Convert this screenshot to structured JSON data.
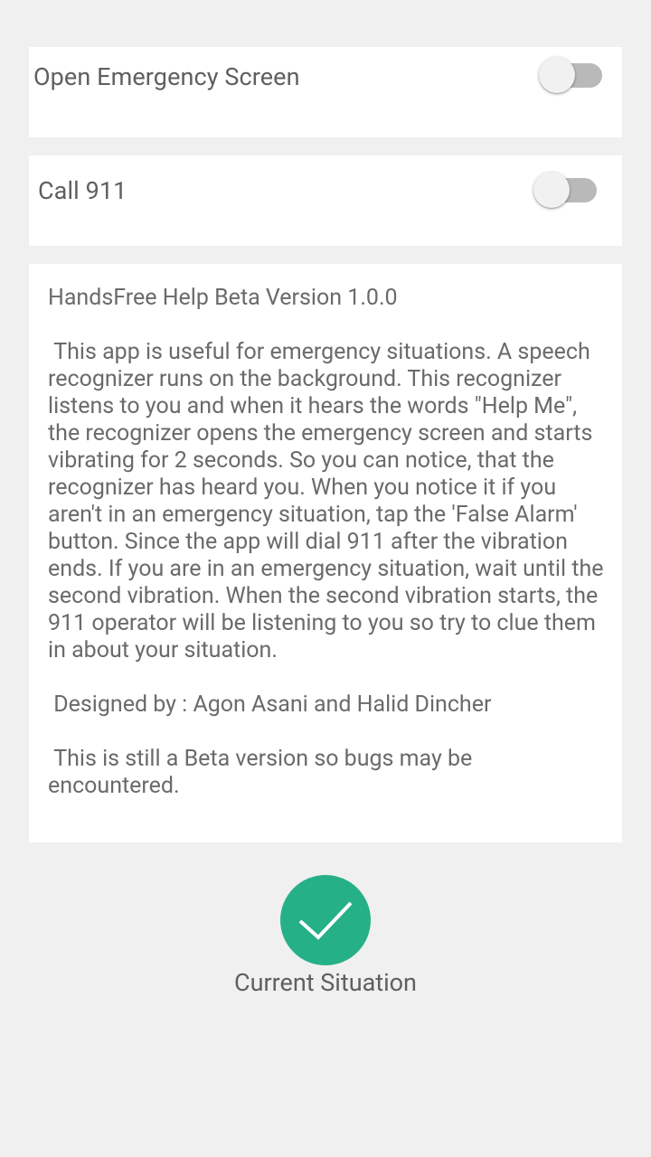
{
  "settings": {
    "emergency_screen": {
      "label": "Open Emergency Screen",
      "enabled": false
    },
    "call_911": {
      "label": "Call 911",
      "enabled": false
    }
  },
  "info": {
    "text": "HandsFree Help Beta Version 1.0.0\n\n This app is useful for emergency situations. A speech recognizer runs on the background. This recognizer listens to you and when it hears the words \"Help Me\", the recognizer opens the emergency screen and starts vibrating for 2 seconds. So you can notice, that the recognizer has heard you. When you notice it if you aren't in an emergency situation, tap the 'False Alarm' button. Since the app will dial 911 after the vibration ends. If you are in an emergency situation, wait until the second vibration. When the second vibration starts, the 911 operator will be listening to you so try to clue them in about your situation.\n\n Designed by : Agon Asani and Halid Dincher\n\n This is still a Beta version so bugs may be encountered."
  },
  "status": {
    "icon": "checkmark-icon",
    "label": "Current Situation",
    "color": "#26b087"
  },
  "colors": {
    "background": "#f0f0f0",
    "card": "#ffffff",
    "switch_track_off": "#b9b9b9",
    "switch_thumb_off": "#f1f1f1"
  }
}
